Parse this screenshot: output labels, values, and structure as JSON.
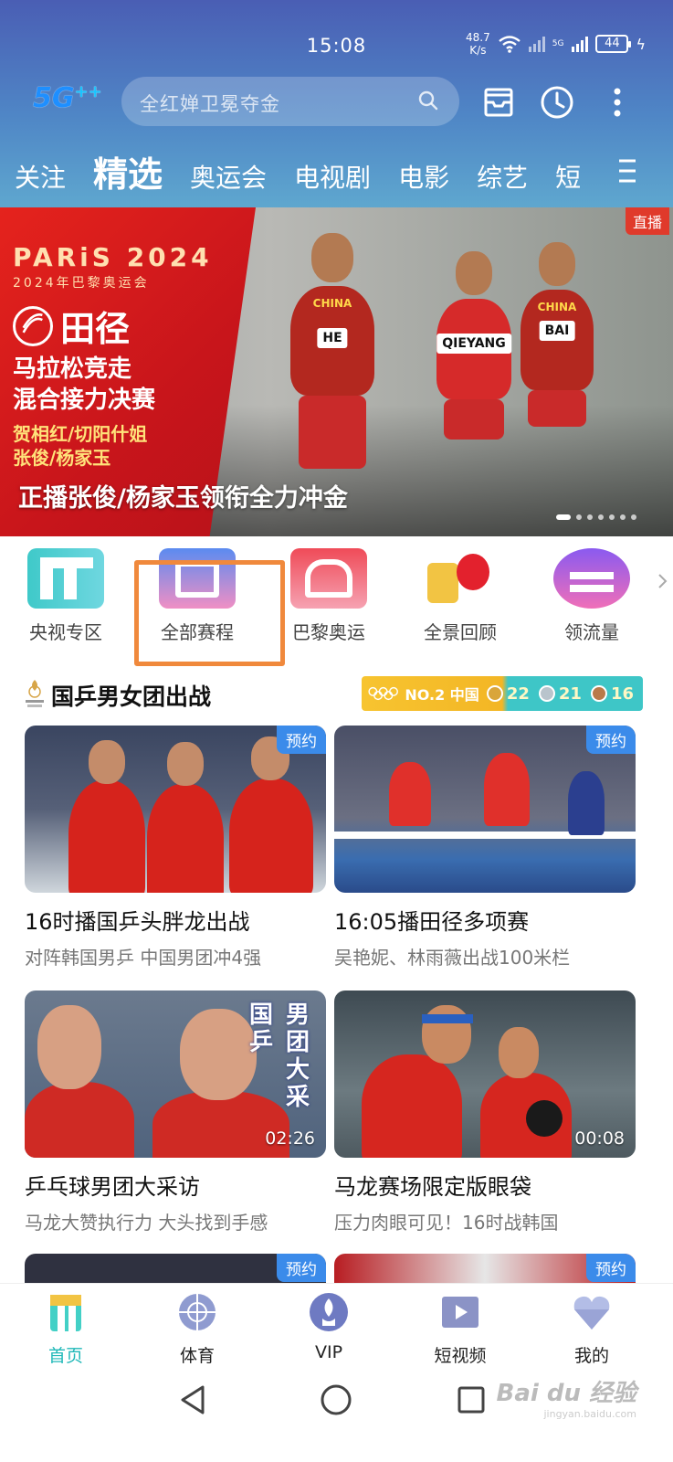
{
  "status_bar": {
    "time": "15:08",
    "net_speed_value": "48.7",
    "net_speed_unit": "K/s",
    "battery": "44",
    "signal_tag": "5G"
  },
  "header": {
    "logo_text": "5G",
    "logo_plus": "++",
    "search_placeholder": "全红婵卫冕夺金",
    "tabs": [
      "关注",
      "精选",
      "奥运会",
      "电视剧",
      "电影",
      "综艺",
      "短"
    ],
    "active_tab": "精选"
  },
  "banner": {
    "paris_title": "PARiS 2024",
    "paris_sub": "2024年巴黎奥运会",
    "sport": "田径",
    "event_line1": "马拉松竞走",
    "event_line2": "混合接力决赛",
    "athletes_line1": "贺相红/切阳什姐",
    "athletes_line2": "张俊/杨家玉",
    "live_label": "直播",
    "caption": "正播张俊/杨家玉领衔全力冲金",
    "bibs": [
      "HE",
      "QIEYANG",
      "BAI"
    ],
    "jersey_text": "CHINA",
    "slide_count": 7,
    "active_slide": 0
  },
  "quick_entries": [
    {
      "label": "央视专区",
      "icon": "cctv-zone-icon"
    },
    {
      "label": "全部赛程",
      "icon": "schedule-icon"
    },
    {
      "label": "巴黎奥运",
      "icon": "paris-olympics-icon"
    },
    {
      "label": "全景回顾",
      "icon": "panorama-review-icon"
    },
    {
      "label": "领流量",
      "icon": "data-bonus-icon"
    }
  ],
  "section": {
    "logo_text": "PARIS 2024",
    "title": "国乒男女团出战",
    "rank_label": "NO.2 中国",
    "gold": "22",
    "silver": "21",
    "bronze": "16"
  },
  "cards": [
    {
      "title": "16时播国乒头胖龙出战",
      "subtitle": "对阵韩国男乒 中国男团冲4强",
      "badge": "预约"
    },
    {
      "title": "16:05播田径多项赛",
      "subtitle": "吴艳妮、林雨薇出战100米栏",
      "badge": "预约"
    },
    {
      "title": "乒乓球男团大采访",
      "subtitle": "马龙大赞执行力 大头找到手感",
      "duration": "02:26",
      "overlay_text1": "国乒",
      "overlay_text2": "男团大采"
    },
    {
      "title": "马龙赛场限定版眼袋",
      "subtitle": "压力肉眼可见！16时战韩国",
      "duration": "00:08"
    },
    {
      "badge": "预约"
    },
    {
      "badge": "预约"
    }
  ],
  "bottom_nav": [
    {
      "label": "首页",
      "icon": "home-icon",
      "active": true
    },
    {
      "label": "体育",
      "icon": "sports-icon"
    },
    {
      "label": "VIP",
      "icon": "vip-icon"
    },
    {
      "label": "短视频",
      "icon": "short-video-icon"
    },
    {
      "label": "我的",
      "icon": "profile-icon"
    }
  ],
  "watermark": {
    "text": "Bai du 经验",
    "sub": "jingyan.baidu.com"
  },
  "colors": {
    "header_top": "#4a5eb4",
    "header_bottom": "#5fa8cf",
    "highlight_border": "#f0893c",
    "badge_blue": "#3b8bea",
    "active_nav": "#20b8b8",
    "banner_red": "#e5231d"
  }
}
